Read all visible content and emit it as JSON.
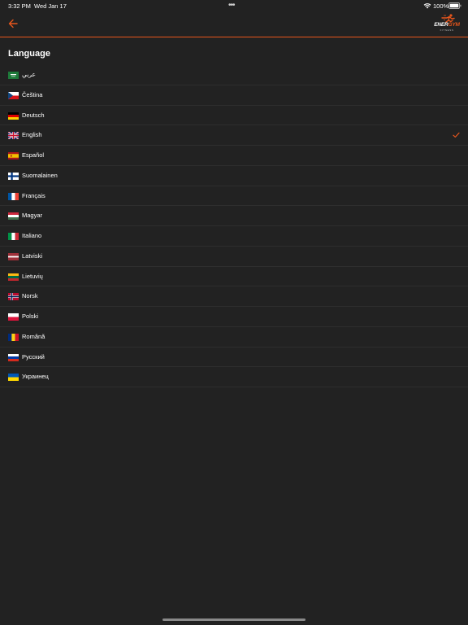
{
  "status_bar": {
    "time": "3:32 PM",
    "date": "Wed Jan 17",
    "battery": "100%"
  },
  "header": {
    "logo_top": "ENER",
    "logo_accent": "GYM",
    "logo_sub": "FITNESS"
  },
  "section_title": "Language",
  "accent_color": "#e8561c",
  "languages": [
    {
      "label": "عربي",
      "flag": "sa"
    },
    {
      "label": "Čeština",
      "flag": "cz"
    },
    {
      "label": "Deutsch",
      "flag": "de"
    },
    {
      "label": "English",
      "flag": "gb",
      "selected": true
    },
    {
      "label": "Español",
      "flag": "es"
    },
    {
      "label": "Suomalainen",
      "flag": "fi"
    },
    {
      "label": "Français",
      "flag": "fr"
    },
    {
      "label": "Magyar",
      "flag": "hu"
    },
    {
      "label": "Italiano",
      "flag": "it"
    },
    {
      "label": "Latviski",
      "flag": "lv"
    },
    {
      "label": "Lietuvių",
      "flag": "lt"
    },
    {
      "label": "Norsk",
      "flag": "no"
    },
    {
      "label": "Polski",
      "flag": "pl"
    },
    {
      "label": "Română",
      "flag": "ro"
    },
    {
      "label": "Русский",
      "flag": "ru"
    },
    {
      "label": "Украинец",
      "flag": "ua"
    }
  ]
}
